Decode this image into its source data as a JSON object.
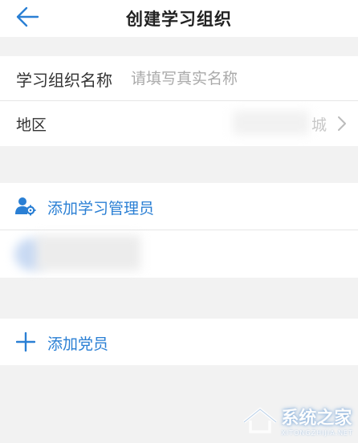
{
  "header": {
    "title": "创建学习组织"
  },
  "form": {
    "name_label": "学习组织名称",
    "name_placeholder": "请填写真实名称",
    "region_label": "地区",
    "region_value_partial": "城"
  },
  "admin_section": {
    "add_admin_label": "添加学习管理员"
  },
  "member_section": {
    "add_member_label": "添加党员"
  },
  "watermark": {
    "text": "系统之家",
    "sub": "XITONGZHIJIA.NET"
  },
  "colors": {
    "accent": "#2a7fd4",
    "background": "#f2f2f2"
  },
  "icons": {
    "back": "arrow-left-icon",
    "chevron": "chevron-right-icon",
    "admin": "user-gear-icon",
    "add": "plus-icon"
  }
}
